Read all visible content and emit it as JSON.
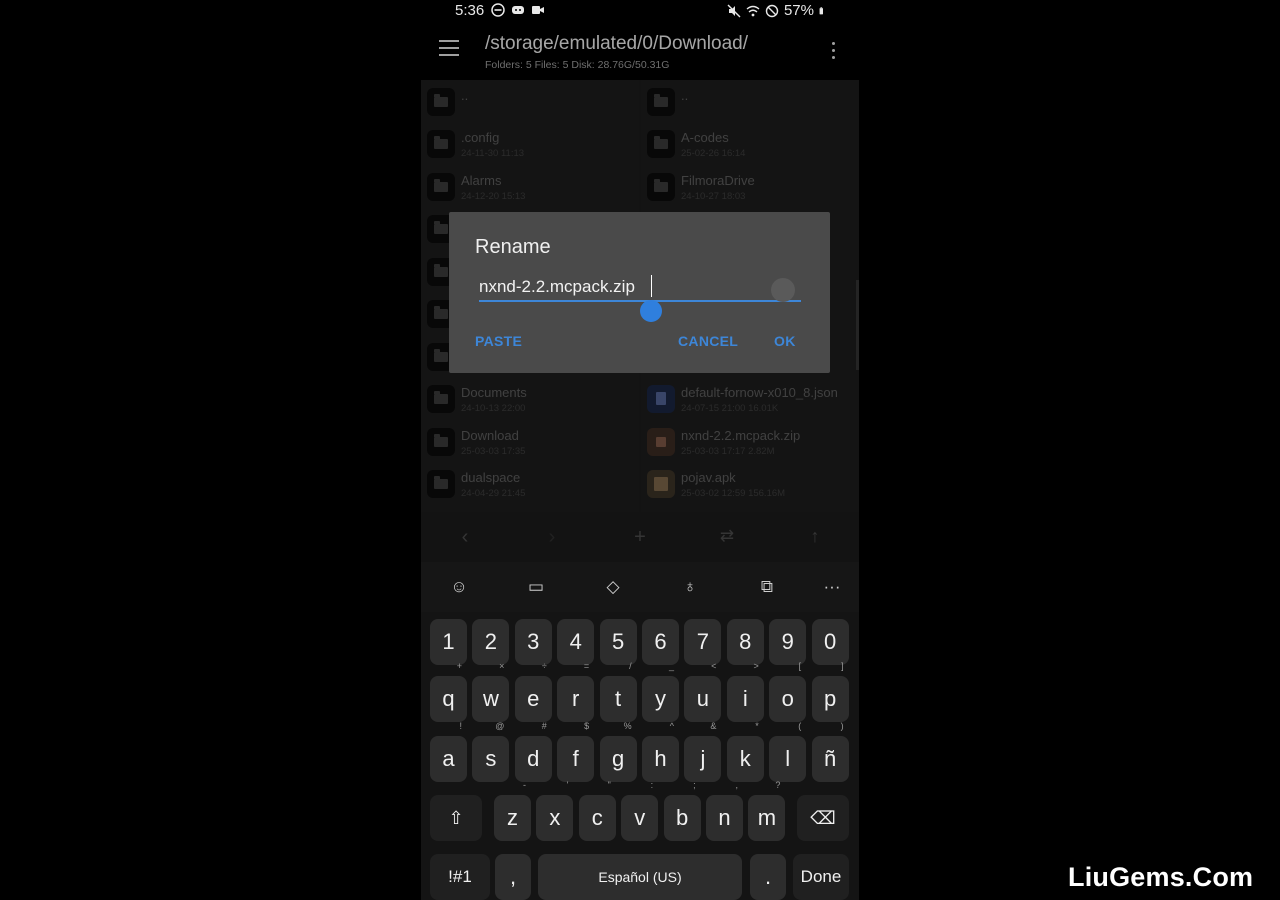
{
  "status_bar": {
    "time": "5:36",
    "battery": "57%",
    "icons": [
      "do-not-disturb-icon",
      "discord-icon",
      "video-icon",
      "mute-icon",
      "wifi-icon",
      "blocked-icon",
      "battery-icon"
    ]
  },
  "app_bar": {
    "path": "/storage/emulated/0/Download/",
    "stats": "Folders: 5  Files: 5  Disk: 28.76G/50.31G"
  },
  "left_pane": {
    "items": [
      {
        "name": "..",
        "meta": ""
      },
      {
        "name": ".config",
        "meta": "24-11-30 11:13"
      },
      {
        "name": "Alarms",
        "meta": "24-12-20 15:13"
      },
      {
        "name": "",
        "meta": ""
      },
      {
        "name": "",
        "meta": ""
      },
      {
        "name": "",
        "meta": ""
      },
      {
        "name": "",
        "meta": ""
      },
      {
        "name": "Documents",
        "meta": "24-10-13 22:00"
      },
      {
        "name": "Download",
        "meta": "25-03-03 17:35"
      },
      {
        "name": "dualspace",
        "meta": "24-04-29 21:45"
      }
    ]
  },
  "right_pane": {
    "items": [
      {
        "name": "..",
        "meta": ""
      },
      {
        "name": "A-codes",
        "meta": "25-02-26 16:14"
      },
      {
        "name": "FilmoraDrive",
        "meta": "24-10-27 18:03"
      },
      {
        "name": "default-fornow-x010_8.json",
        "meta": "24-07-15 21:00  16.01K"
      },
      {
        "name": "nxnd-2.2.mcpack.zip",
        "meta": "25-03-03 17:17  2.82M"
      },
      {
        "name": "pojav.apk",
        "meta": "25-03-02 12:59  156.16M"
      }
    ]
  },
  "toolbar": {
    "icons": [
      "back-arrow-icon",
      "forward-arrow-icon",
      "add-icon",
      "swap-icon",
      "up-arrow-icon"
    ]
  },
  "dialog": {
    "title": "Rename",
    "value": "nxnd-2.2.mcpack.zip",
    "paste_label": "PASTE",
    "cancel_label": "CANCEL",
    "ok_label": "OK"
  },
  "keyboard": {
    "toolbar_icons": [
      "emoji-icon",
      "clipboard-icon",
      "cursor-move-icon",
      "mic-icon",
      "translate-icon",
      "more-icon"
    ],
    "row_numbers": [
      "1",
      "2",
      "3",
      "4",
      "5",
      "6",
      "7",
      "8",
      "9",
      "0"
    ],
    "row_q": [
      {
        "k": "q",
        "h": "+"
      },
      {
        "k": "w",
        "h": "×"
      },
      {
        "k": "e",
        "h": "÷"
      },
      {
        "k": "r",
        "h": "="
      },
      {
        "k": "t",
        "h": "/"
      },
      {
        "k": "y",
        "h": "_"
      },
      {
        "k": "u",
        "h": "<"
      },
      {
        "k": "i",
        "h": ">"
      },
      {
        "k": "o",
        "h": "["
      },
      {
        "k": "p",
        "h": "]"
      }
    ],
    "row_a": [
      {
        "k": "a",
        "h": "!"
      },
      {
        "k": "s",
        "h": "@"
      },
      {
        "k": "d",
        "h": "#"
      },
      {
        "k": "f",
        "h": "$"
      },
      {
        "k": "g",
        "h": "%"
      },
      {
        "k": "h",
        "h": "^"
      },
      {
        "k": "j",
        "h": "&"
      },
      {
        "k": "k",
        "h": "*"
      },
      {
        "k": "l",
        "h": "("
      },
      {
        "k": "ñ",
        "h": ")"
      }
    ],
    "row_z": [
      {
        "k": "z",
        "h": "-"
      },
      {
        "k": "x",
        "h": "'"
      },
      {
        "k": "c",
        "h": "\""
      },
      {
        "k": "v",
        "h": ":"
      },
      {
        "k": "b",
        "h": ";"
      },
      {
        "k": "n",
        "h": ","
      },
      {
        "k": "m",
        "h": "?"
      }
    ],
    "symbols_label": "!#1",
    "comma": ",",
    "space_label": "Español (US)",
    "period": ".",
    "done_label": "Done"
  },
  "watermark": "LiuGems.Com"
}
